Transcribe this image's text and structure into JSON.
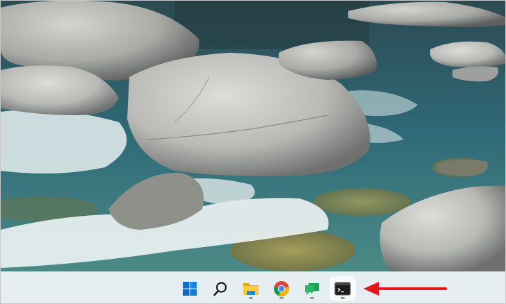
{
  "desktop": {
    "wallpaper_icon": "river-rocks-wallpaper"
  },
  "taskbar": {
    "accent": "#0078d4",
    "items": [
      {
        "icon": "windows-start-icon",
        "active": false,
        "running": false
      },
      {
        "icon": "search-icon",
        "active": false,
        "running": false
      },
      {
        "icon": "file-explorer-icon",
        "active": false,
        "running": true
      },
      {
        "icon": "chrome-icon",
        "active": false,
        "running": true
      },
      {
        "icon": "chat-icon",
        "active": false,
        "running": true
      },
      {
        "icon": "terminal-icon",
        "active": true,
        "running": true
      }
    ]
  },
  "annotation": {
    "arrow_color": "#e3161b",
    "points_to": "terminal-icon"
  }
}
